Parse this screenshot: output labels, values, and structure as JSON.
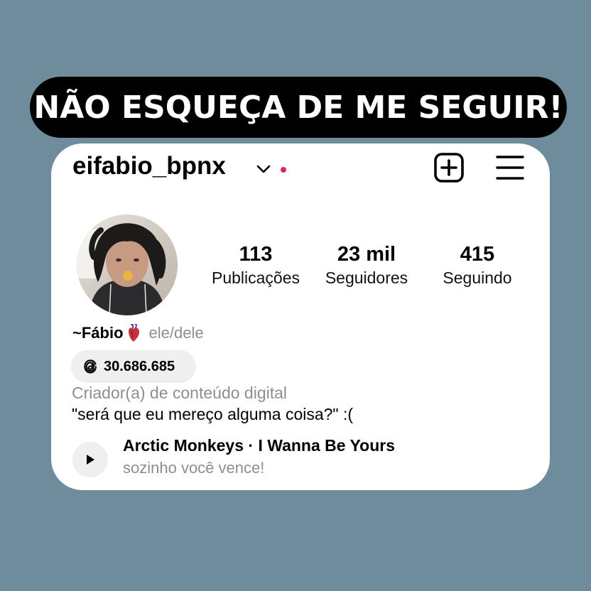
{
  "banner": {
    "text": "NÃO ESQUEÇA DE ME SEGUIR!"
  },
  "header": {
    "username": "eifabio_bpnx",
    "icons": [
      "chevron-down-icon",
      "notification-dot-icon",
      "create-post-icon",
      "menu-icon"
    ]
  },
  "stats": [
    {
      "value": "113",
      "label": "Publicações"
    },
    {
      "value": "23 mil",
      "label": "Seguidores"
    },
    {
      "value": "415",
      "label": "Seguindo"
    }
  ],
  "profile": {
    "name": "~Fábio",
    "name_icon": "anatomical-heart-icon",
    "pronouns": "ele/dele",
    "threads_count": "30.686.685",
    "threads_icon": "threads-icon",
    "category": "Criador(a) de conteúdo digital",
    "bio": "\"será que eu mereço alguma coisa?\" :("
  },
  "music": {
    "song": "Arctic Monkeys · I Wanna Be Yours",
    "subtitle": "sozinho você vence!",
    "icon": "play-icon"
  },
  "colors": {
    "background": "#6f8c9c",
    "banner": "#000000",
    "card": "#ffffff",
    "notification_dot": "#e0245e",
    "secondary_text": "#8e8e8e",
    "pill": "#efefef"
  }
}
